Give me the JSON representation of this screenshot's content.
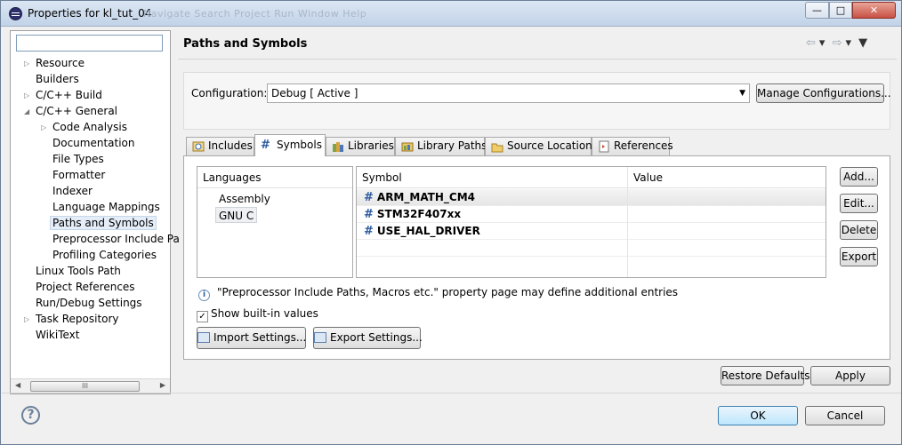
{
  "window": {
    "title": "Properties for kl_tut_04",
    "ghost_menu": "Navigate   Search   Project   Run   Window   Help",
    "controls": {
      "minimize": "—",
      "maximize": "□",
      "close": "✕"
    }
  },
  "left_pane": {
    "filter_value": "",
    "tree": [
      {
        "label": "Resource",
        "level": 1,
        "expander": "collapsed"
      },
      {
        "label": "Builders",
        "level": 1,
        "expander": "none"
      },
      {
        "label": "C/C++ Build",
        "level": 1,
        "expander": "collapsed"
      },
      {
        "label": "C/C++ General",
        "level": 1,
        "expander": "expanded"
      },
      {
        "label": "Code Analysis",
        "level": 2,
        "expander": "collapsed"
      },
      {
        "label": "Documentation",
        "level": 2,
        "expander": "none"
      },
      {
        "label": "File Types",
        "level": 2,
        "expander": "none"
      },
      {
        "label": "Formatter",
        "level": 2,
        "expander": "none"
      },
      {
        "label": "Indexer",
        "level": 2,
        "expander": "none"
      },
      {
        "label": "Language Mappings",
        "level": 2,
        "expander": "none"
      },
      {
        "label": "Paths and Symbols",
        "level": 2,
        "expander": "none",
        "selected": true
      },
      {
        "label": "Preprocessor Include Pa",
        "level": 2,
        "expander": "none"
      },
      {
        "label": "Profiling Categories",
        "level": 2,
        "expander": "none"
      },
      {
        "label": "Linux Tools Path",
        "level": 1,
        "expander": "none"
      },
      {
        "label": "Project References",
        "level": 1,
        "expander": "none"
      },
      {
        "label": "Run/Debug Settings",
        "level": 1,
        "expander": "none"
      },
      {
        "label": "Task Repository",
        "level": 1,
        "expander": "collapsed"
      },
      {
        "label": "WikiText",
        "level": 1,
        "expander": "none"
      }
    ],
    "scrollbar_thumb": "III"
  },
  "page": {
    "title": "Paths and Symbols",
    "nav": {
      "back": "⇦",
      "forward": "⇨",
      "dropdown": "▾",
      "menu": "▼"
    }
  },
  "configuration": {
    "label": "Configuration:",
    "selected": "Debug  [ Active ]",
    "manage_label": "Manage Configurations..."
  },
  "tabs": [
    {
      "label": "Includes",
      "icon": "include-icon"
    },
    {
      "label": "Symbols",
      "icon": "hash-icon",
      "active": true
    },
    {
      "label": "Libraries",
      "icon": "library-icon"
    },
    {
      "label": "Library Paths",
      "icon": "library-path-icon"
    },
    {
      "label": "Source Location",
      "icon": "folder-icon"
    },
    {
      "label": "References",
      "icon": "references-icon"
    }
  ],
  "languages": {
    "header": "Languages",
    "items": [
      "Assembly",
      "GNU C"
    ],
    "selected": "GNU C"
  },
  "symbols": {
    "col_symbol": "Symbol",
    "col_value": "Value",
    "hash": "#",
    "rows": [
      {
        "name": "ARM_MATH_CM4",
        "value": ""
      },
      {
        "name": "STM32F407xx",
        "value": ""
      },
      {
        "name": "USE_HAL_DRIVER",
        "value": ""
      }
    ]
  },
  "side_buttons": {
    "add": "Add...",
    "edit": "Edit...",
    "delete": "Delete",
    "export": "Export"
  },
  "info_text": "\"Preprocessor Include Paths, Macros etc.\" property page may define additional entries",
  "info_icon": "i",
  "show_builtin": {
    "label": "Show built-in values",
    "checked": true,
    "mark": "✓"
  },
  "settings_buttons": {
    "import": "Import Settings...",
    "export": "Export Settings..."
  },
  "footer": {
    "restore_defaults": "Restore Defaults",
    "apply": "Apply",
    "ok": "OK",
    "cancel": "Cancel",
    "help": "?"
  }
}
